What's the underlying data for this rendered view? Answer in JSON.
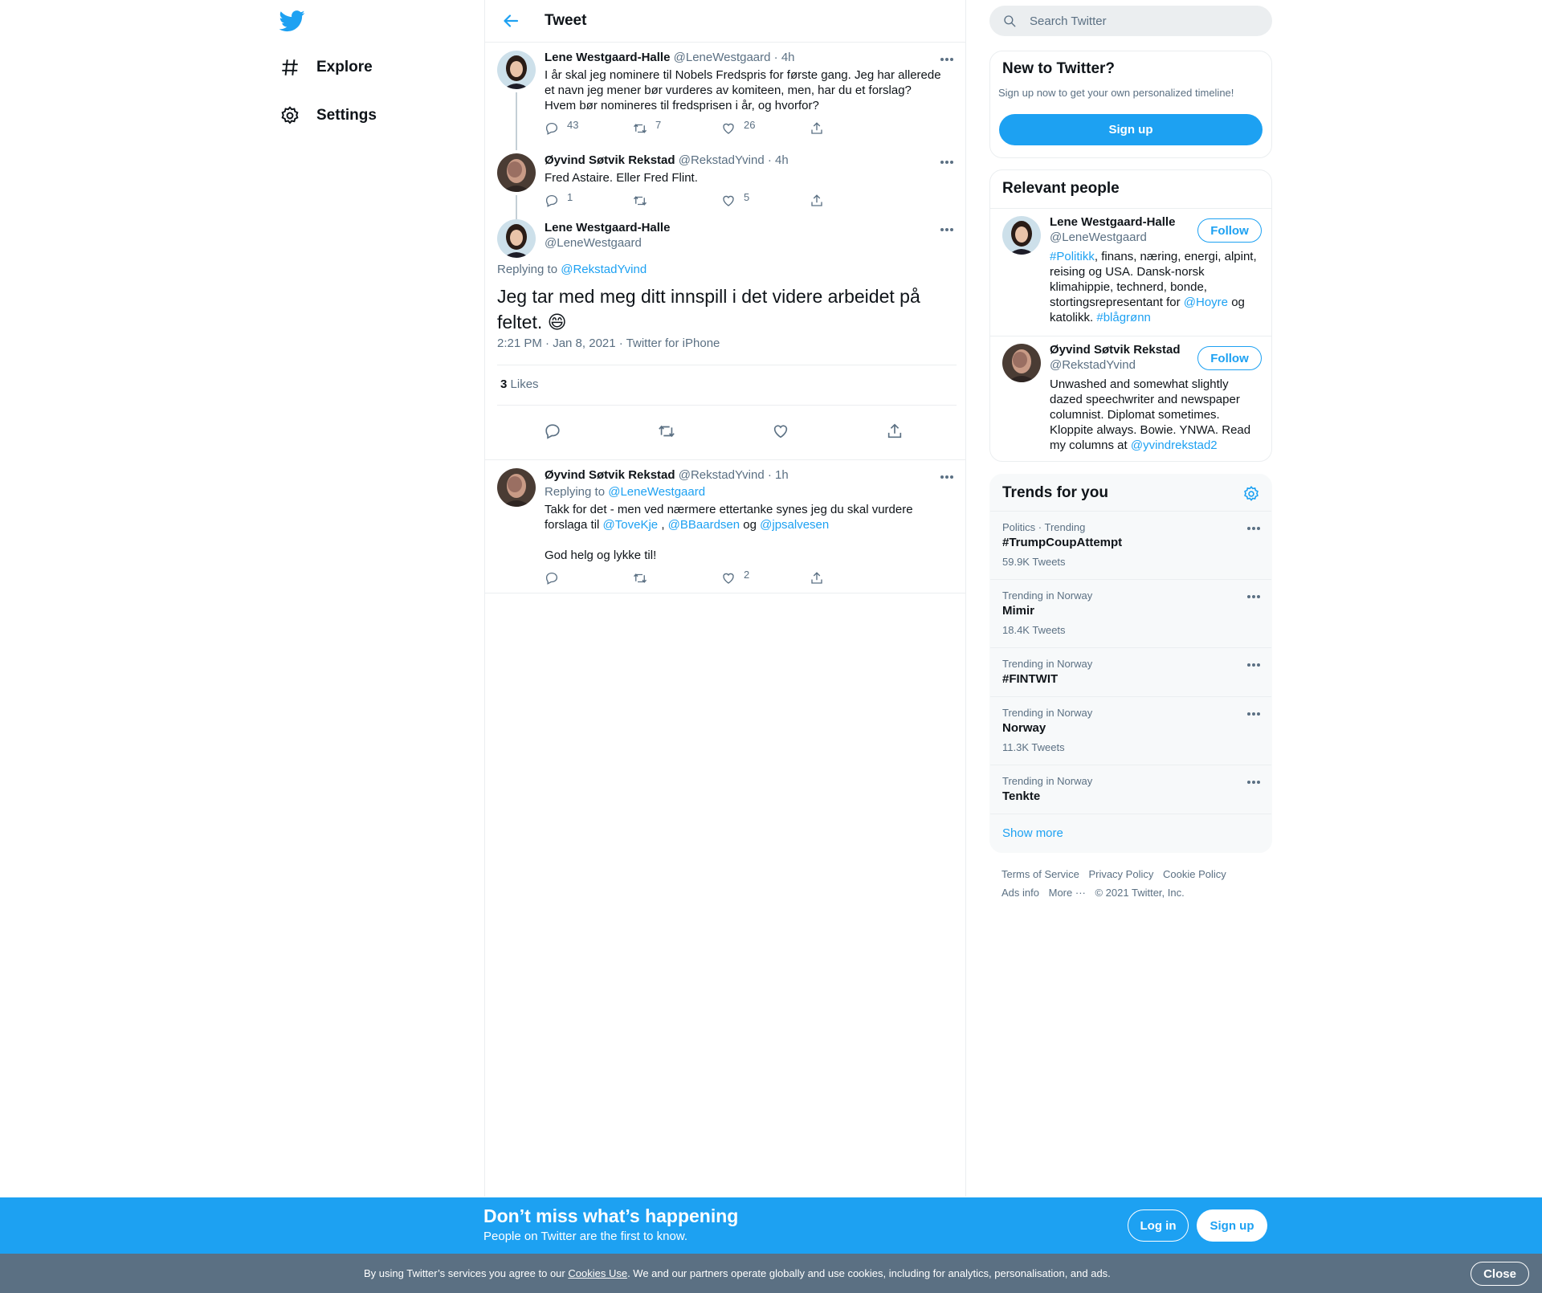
{
  "nav": {
    "explore_label": "Explore",
    "settings_label": "Settings"
  },
  "header": {
    "title": "Tweet"
  },
  "thread": [
    {
      "author_name": "Lene Westgaard-Halle",
      "handle": "@LeneWestgaard",
      "time": "4h",
      "text": "I år skal jeg nominere til Nobels Fredspris for første gang. Jeg har allerede et navn jeg mener bør vurderes av komiteen, men, har du et forslag? Hvem bør nomineres til fredsprisen i år, og hvorfor?",
      "replies": "43",
      "retweets": "7",
      "likes": "26"
    },
    {
      "author_name": "Øyvind Søtvik Rekstad",
      "handle": "@RekstadYvind",
      "time": "4h",
      "text": "Fred Astaire. Eller Fred Flint.",
      "replies": "1",
      "retweets": "",
      "likes": "5"
    }
  ],
  "focus_tweet": {
    "author_name": "Lene Westgaard-Halle",
    "handle": "@LeneWestgaard",
    "replying_prefix": "Replying to",
    "replying_to": "@RekstadYvind",
    "text": "Jeg tar med meg ditt innspill i det videre arbeidet på feltet.",
    "emoji": "😄",
    "timestamp": "2:21 PM · Jan 8, 2021",
    "source": "Twitter for iPhone",
    "likes_count": "3",
    "likes_label": "Likes"
  },
  "reply": {
    "author_name": "Øyvind Søtvik Rekstad",
    "handle": "@RekstadYvind",
    "time": "1h",
    "replying_prefix": "Replying to",
    "replying_to": "@LeneWestgaard",
    "text_1": "Takk for det - men ved nærmere ettertanke synes jeg du skal vurdere forslaga til",
    "mention_1": "@ToveKje",
    "sep_1": ",",
    "mention_2": "@BBaardsen",
    "sep_2": "og",
    "mention_3": "@jpsalvesen",
    "text_2": "God helg og lykke til!",
    "replies": "",
    "retweets": "",
    "likes": "2"
  },
  "search": {
    "placeholder": "Search Twitter"
  },
  "new_to_twitter": {
    "title": "New to Twitter?",
    "subtitle": "Sign up now to get your own personalized timeline!",
    "button": "Sign up"
  },
  "relevant_people": {
    "title": "Relevant people",
    "follow_label": "Follow",
    "people": [
      {
        "name": "Lene Westgaard-Halle",
        "handle": "@LeneWestgaard",
        "bio_tag": "#Politikk",
        "bio_1": ", finans, næring, energi, alpint, reising og USA. Dansk-norsk klimahippie, technerd, bonde, stortingsrepresentant for",
        "bio_mention": "@Hoyre",
        "bio_2": "og katolikk.",
        "bio_tag2": "#blågrønn"
      },
      {
        "name": "Øyvind Søtvik Rekstad",
        "handle": "@RekstadYvind",
        "bio_1": "Unwashed and somewhat slightly dazed speechwriter and newspaper columnist. Diplomat sometimes. Kloppite always. Bowie. YNWA. Read my columns at",
        "bio_mention": "@yvindrekstad2"
      }
    ]
  },
  "trends": {
    "title": "Trends for you",
    "items": [
      {
        "meta": "Politics · Trending",
        "name": "#TrumpCoupAttempt",
        "count": "59.9K Tweets"
      },
      {
        "meta": "Trending in Norway",
        "name": "Mimir",
        "count": "18.4K Tweets"
      },
      {
        "meta": "Trending in Norway",
        "name": "#FINTWIT",
        "count": ""
      },
      {
        "meta": "Trending in Norway",
        "name": "Norway",
        "count": "11.3K Tweets"
      },
      {
        "meta": "Trending in Norway",
        "name": "Tenkte",
        "count": ""
      }
    ],
    "show_more": "Show more"
  },
  "footer": {
    "terms": "Terms of Service",
    "privacy": "Privacy Policy",
    "cookie": "Cookie Policy",
    "ads": "Ads info",
    "more": "More",
    "copyright": "© 2021 Twitter, Inc."
  },
  "bottom_bar": {
    "title": "Don’t miss what’s happening",
    "subtitle": "People on Twitter are the first to know.",
    "login": "Log in",
    "signup": "Sign up"
  },
  "cookie_bar": {
    "text_1": "By using Twitter’s services you agree to our",
    "link": "Cookies Use",
    "text_2": ". We and our partners operate globally and use cookies, including for analytics, personalisation, and ads.",
    "close": "Close"
  },
  "colors": {
    "brand": "#1da1f2",
    "text": "#0f1419",
    "secondary": "#5b7083",
    "border": "#ebeef0",
    "cookie_bar": "#5b7083"
  }
}
